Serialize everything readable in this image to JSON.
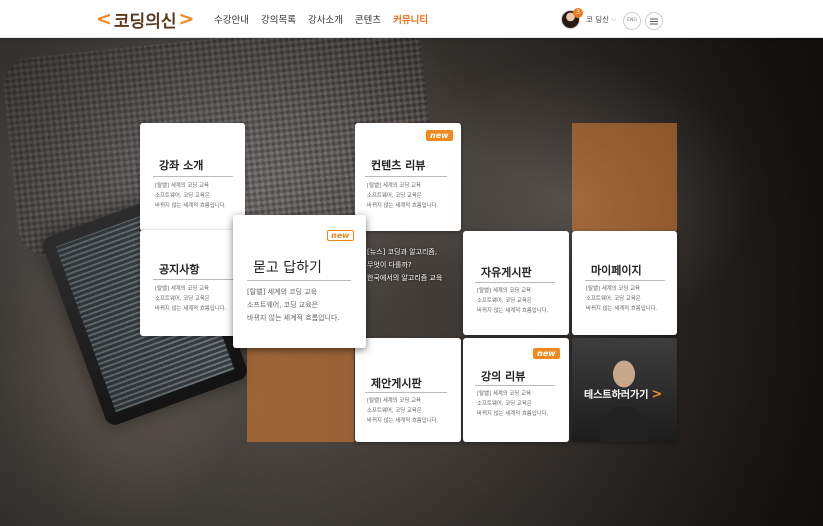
{
  "header": {
    "logo": {
      "left_bracket": "<",
      "text": "코딩의신",
      "right_bracket": ">"
    },
    "nav": [
      {
        "label": "수강안내",
        "active": false
      },
      {
        "label": "강의목록",
        "active": false
      },
      {
        "label": "강사소개",
        "active": false
      },
      {
        "label": "콘텐츠",
        "active": false
      },
      {
        "label": "커뮤니티",
        "active": true
      }
    ],
    "user": {
      "badge": "3",
      "name": "코 딩신"
    },
    "lang_label": "ENG"
  },
  "tiles": {
    "course_intro": {
      "title": "강좌 소개",
      "desc": [
        "[탈밸] 세계의 코딩 교육",
        "소프트웨어, 코딩 교육은",
        "바뀌지 않는 세계적 흐름입니다."
      ]
    },
    "content_review": {
      "title": "컨텐츠 리뷰",
      "badge": "new",
      "desc": [
        "[탈밸] 세계의 코딩 교육",
        "소프트웨어, 코딩 교육은",
        "바뀌지 않는 세계적 흐름입니다."
      ]
    },
    "notice": {
      "title": "공지사항",
      "desc": [
        "[탈밸] 세계의 코딩 교육",
        "소프트웨어, 코딩 교육은",
        "바뀌지 않는 세계적 흐름입니다."
      ]
    },
    "qna": {
      "title": "묻고 답하기",
      "badge": "new",
      "desc": [
        "[탈밸] 세계의 코딩 교육",
        "소프트웨어, 코딩 교육은",
        "바뀌지 않는 세계적 흐름입니다."
      ]
    },
    "news": {
      "lines": [
        "[뉴스] 코딩과 알고리즘,",
        "무엇이 다를까?",
        "한국에서의 알고리즘 교육"
      ]
    },
    "free_board": {
      "title": "자유게시판",
      "desc": [
        "[탈밸] 세계의 코딩 교육",
        "소프트웨어, 코딩 교육은",
        "바뀌지 않는 세계적 흐름입니다."
      ]
    },
    "mypage": {
      "title": "마이페이지",
      "desc": [
        "[탈밸] 세계의 코딩 교육",
        "소프트웨어, 코딩 교육은",
        "바뀌지 않는 세계적 흐름입니다."
      ]
    },
    "suggestion_board": {
      "title": "제안게시판",
      "desc": [
        "[탈밸] 세계의 코딩 교육",
        "소프트웨어, 코딩 교육은",
        "바뀌지 않는 세계적 흐름입니다."
      ]
    },
    "lecture_review": {
      "title": "강의 리뷰",
      "badge": "new",
      "desc": [
        "[탈밸] 세계의 코딩 교육",
        "소프트웨어, 코딩 교육은",
        "바뀌지 않는 세계적 흐름입니다."
      ]
    },
    "test": {
      "label": "테스트하러가기",
      "arrow": ">"
    }
  },
  "colors": {
    "accent": "#f08a1e",
    "active_nav": "#f0701e"
  }
}
